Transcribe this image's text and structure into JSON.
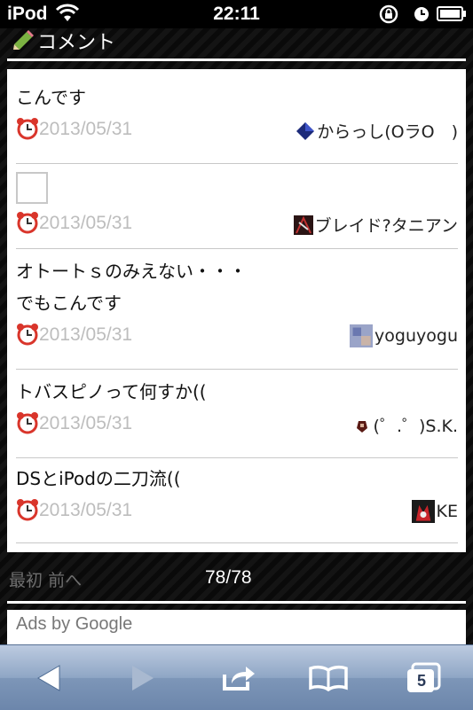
{
  "status_bar": {
    "carrier": "iPod",
    "time": "22:11"
  },
  "section": {
    "title": "コメント"
  },
  "comments": [
    {
      "text_lines": [
        "こんです"
      ],
      "date": "2013/05/31",
      "user": "からっし(OラO　)",
      "avatar_icon": "diamond-icon"
    },
    {
      "text_lines": [],
      "has_thumbnail": true,
      "date": "2013/05/31",
      "user": "ブレイド?タニアン",
      "avatar_icon": "user-avatar"
    },
    {
      "text_lines": [
        "オトートｓのみえない・・・",
        "でもこんです"
      ],
      "date": "2013/05/31",
      "user": "yoguyogu",
      "avatar_icon": "user-avatar"
    },
    {
      "text_lines": [
        "トバスピノって何すか(("
      ],
      "date": "2013/05/31",
      "user": "(゜.゜)S.K.",
      "avatar_icon": "user-avatar"
    },
    {
      "text_lines": [
        "DSとiPodの二刀流(("
      ],
      "date": "2013/05/31",
      "user": "KE",
      "avatar_icon": "user-avatar"
    }
  ],
  "pager": {
    "first": "最初",
    "prev": "前へ",
    "count": "78/78"
  },
  "ads": {
    "label": "Ads by Google"
  },
  "toolbar": {
    "tabs_count": "5",
    "icons": [
      "back-icon",
      "forward-icon",
      "share-icon",
      "bookmarks-icon",
      "tabs-icon"
    ]
  }
}
